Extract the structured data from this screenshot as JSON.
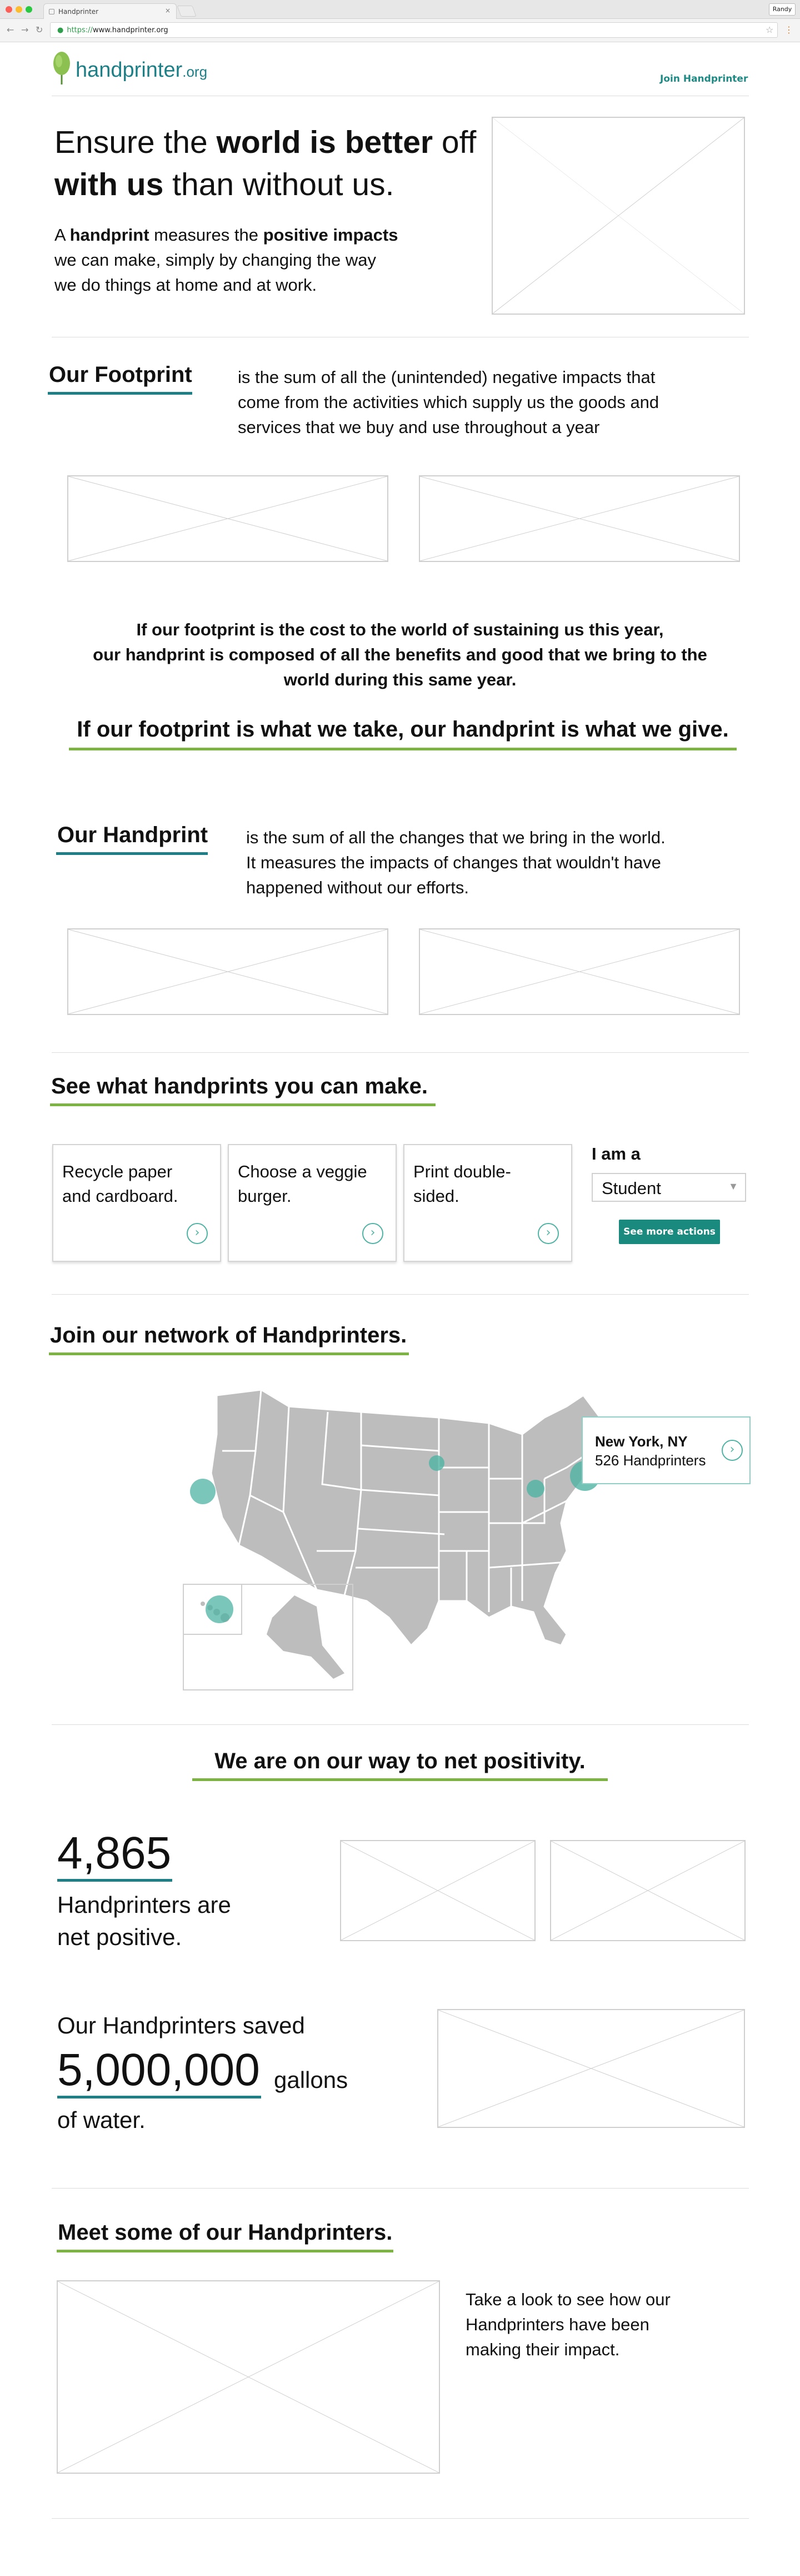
{
  "browser": {
    "tab_title": "Handprinter",
    "url_scheme": "https://",
    "url_host": "www.handprinter.org",
    "profile_label": "Randy"
  },
  "header": {
    "logo_text_main": "handprinter",
    "logo_text_suffix": ".org",
    "join_link": "Join Handprinter"
  },
  "hero": {
    "line1_pre": "Ensure the ",
    "line1_bold": "world is better",
    "line1_post": " off",
    "line2_bold": "with us",
    "line2_post": " than without us.",
    "desc_a": "A ",
    "desc_b": "handprint",
    "desc_c": " measures the ",
    "desc_d": "positive impacts",
    "desc_line2": "we can make, simply by changing the way",
    "desc_line3": "we do things at home and at work."
  },
  "footprint": {
    "heading": "Our Footprint",
    "line1": "is the sum of all the (unintended) negative impacts that",
    "line2": "come from the activities which supply us the goods and",
    "line3": "services that we buy and use throughout a year"
  },
  "bridge": {
    "line1": "If our footprint is the cost to the world of sustaining us this year,",
    "line2": "our handprint is composed of all the benefits and good that we bring to the",
    "line3": "world during this same year.",
    "tagline": "If our footprint is what we take, our handprint is what we give."
  },
  "handprint": {
    "heading": "Our Handprint",
    "line1": "is the sum of all the changes that we bring in the world.",
    "line2": "It measures the impacts of changes that wouldn't have",
    "line3": "happened without our efforts."
  },
  "actions": {
    "heading": "See what handprints you can make.",
    "cards": [
      {
        "line1": "Recycle paper",
        "line2": "and cardboard."
      },
      {
        "line1": "Choose a veggie",
        "line2": "burger."
      },
      {
        "line1": "Print double-",
        "line2": "sided."
      }
    ],
    "role_label": "I am a",
    "role_value": "Student",
    "more_button": "See more actions"
  },
  "network": {
    "heading": "Join our network of Handprinters.",
    "tooltip_city": "New York, NY",
    "tooltip_count": "526 Handprinters"
  },
  "positivity": {
    "heading": "We are on our way to net positivity.",
    "count": "4,865",
    "count_line1": "Handprinters are",
    "count_line2": "net positive.",
    "saved_intro": "Our Handprinters saved",
    "saved_value": "5,000,000",
    "saved_unit": "gallons",
    "saved_tail": "of water."
  },
  "meet": {
    "heading": "Meet some of our Handprinters.",
    "line1": "Take a look to see how our",
    "line2": "Handprinters have been",
    "line3": "making their impact."
  },
  "colors": {
    "teal": "#1f7f86",
    "green": "#7cb342",
    "button": "#1b8a7e",
    "map_state": "#bdbdbd",
    "map_marker": "#4fb3a4"
  }
}
